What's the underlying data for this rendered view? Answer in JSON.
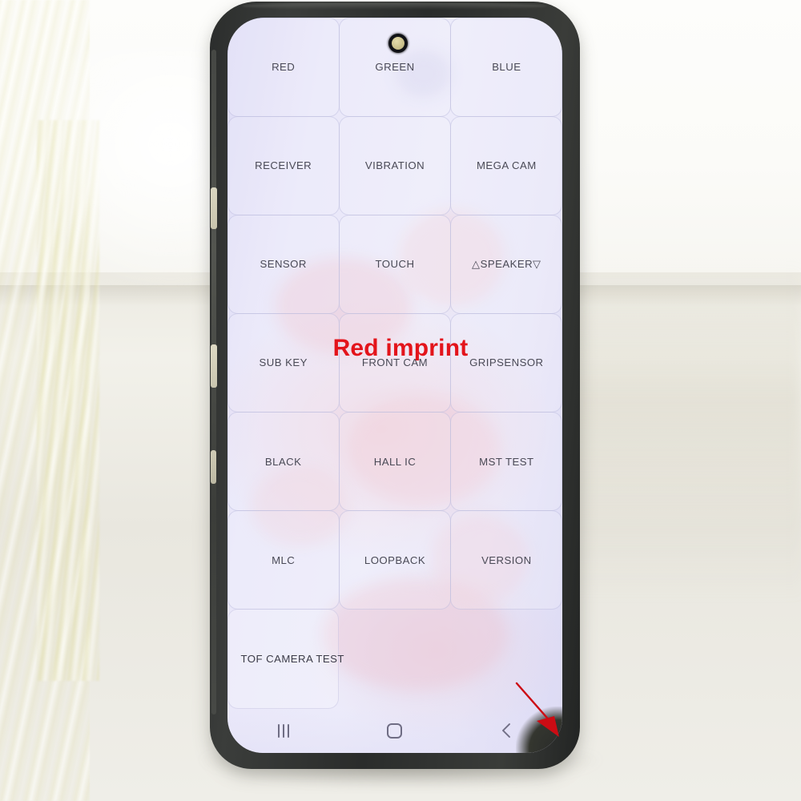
{
  "photo": {
    "subject": "smartphone-display-defect-photo",
    "annotation_text": "Red imprint"
  },
  "device": {
    "screen_state": "factory-test-menu",
    "accent_red": "#e3141b",
    "screen_tint": "#e8e6f8"
  },
  "test_menu": {
    "rows": [
      {
        "cells": [
          {
            "label": "RED"
          },
          {
            "label": "GREEN"
          },
          {
            "label": "BLUE"
          }
        ]
      },
      {
        "cells": [
          {
            "label": "RECEIVER"
          },
          {
            "label": "VIBRATION"
          },
          {
            "label": "MEGA CAM"
          }
        ]
      },
      {
        "cells": [
          {
            "label": "SENSOR"
          },
          {
            "label": "TOUCH"
          },
          {
            "label": "△SPEAKER▽"
          }
        ]
      },
      {
        "cells": [
          {
            "label": "SUB KEY"
          },
          {
            "label": "FRONT CAM"
          },
          {
            "label": "GRIPSENSOR"
          }
        ]
      },
      {
        "cells": [
          {
            "label": "BLACK"
          },
          {
            "label": "HALL IC"
          },
          {
            "label": "MST TEST"
          }
        ]
      },
      {
        "cells": [
          {
            "label": "MLC"
          },
          {
            "label": "LOOPBACK"
          },
          {
            "label": "VERSION"
          }
        ]
      }
    ],
    "full_width_row": {
      "label": "TOF CAMERA TEST"
    }
  },
  "navbar": {
    "recents_label": "recents",
    "home_label": "home",
    "back_label": "back"
  },
  "icons": {
    "punch_hole_camera": "front-camera-icon",
    "nav_recents": "recents-icon",
    "nav_home": "home-icon",
    "nav_back": "back-chevron-icon",
    "pointer": "red-arrow-icon"
  }
}
